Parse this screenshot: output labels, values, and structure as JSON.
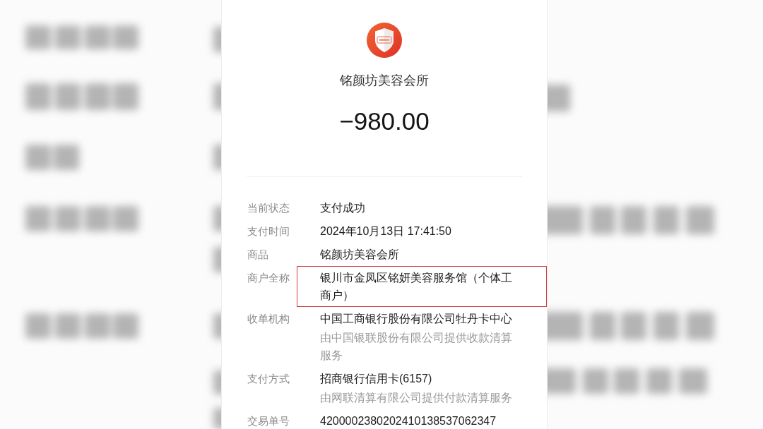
{
  "merchant": {
    "name": "铭颜坊美容会所"
  },
  "amount": "−980.00",
  "details": [
    {
      "label": "当前状态",
      "value": "支付成功",
      "highlighted": false
    },
    {
      "label": "支付时间",
      "value": "2024年10月13日 17:41:50",
      "highlighted": false
    },
    {
      "label": "商品",
      "value": "铭颜坊美容会所",
      "highlighted": false
    },
    {
      "label": "商户全称",
      "value": "银川市金凤区铭妍美容服务馆（个体工商户）",
      "highlighted": true
    },
    {
      "label": "收单机构",
      "value": "中国工商银行股份有限公司牡丹卡中心",
      "note": "由中国银联股份有限公司提供收款清算服务",
      "highlighted": false
    },
    {
      "label": "支付方式",
      "value": "招商银行信用卡(6157)",
      "note": "由网联清算有限公司提供付款清算服务",
      "highlighted": false
    },
    {
      "label": "交易单号",
      "value": "4200002380202410138537062347",
      "highlighted": false
    }
  ]
}
